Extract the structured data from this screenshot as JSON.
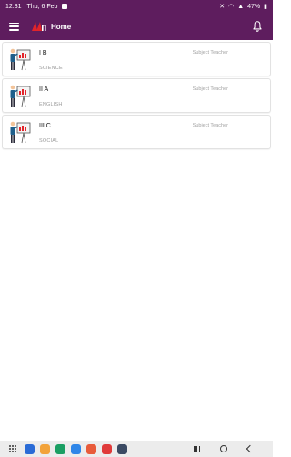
{
  "status_bar": {
    "time": "12:31",
    "date": "Thu, 6 Feb",
    "battery": "47%"
  },
  "app_bar": {
    "title": "Home",
    "menu_icon": "hamburger-menu-icon",
    "bell_icon": "bell-icon",
    "color": "#5e1d5e"
  },
  "classes": [
    {
      "class_name": "I B",
      "teacher_label": "Subject Teacher",
      "subject": "SCIENCE"
    },
    {
      "class_name": "II A",
      "teacher_label": "Subject Teacher",
      "subject": "ENGLISH"
    },
    {
      "class_name": "III C",
      "teacher_label": "Subject Teacher",
      "subject": "SOCIAL"
    }
  ],
  "taskbar": {
    "apps": [
      {
        "name": "app-1",
        "color": "#2a6bd6"
      },
      {
        "name": "app-2",
        "color": "#f2a33a"
      },
      {
        "name": "app-3",
        "color": "#1a9f63"
      },
      {
        "name": "app-4",
        "color": "#2f86e8"
      },
      {
        "name": "app-5",
        "color": "#e85b3a"
      },
      {
        "name": "app-6",
        "color": "#e03a3a"
      },
      {
        "name": "app-7",
        "color": "#3b4a63"
      }
    ]
  }
}
